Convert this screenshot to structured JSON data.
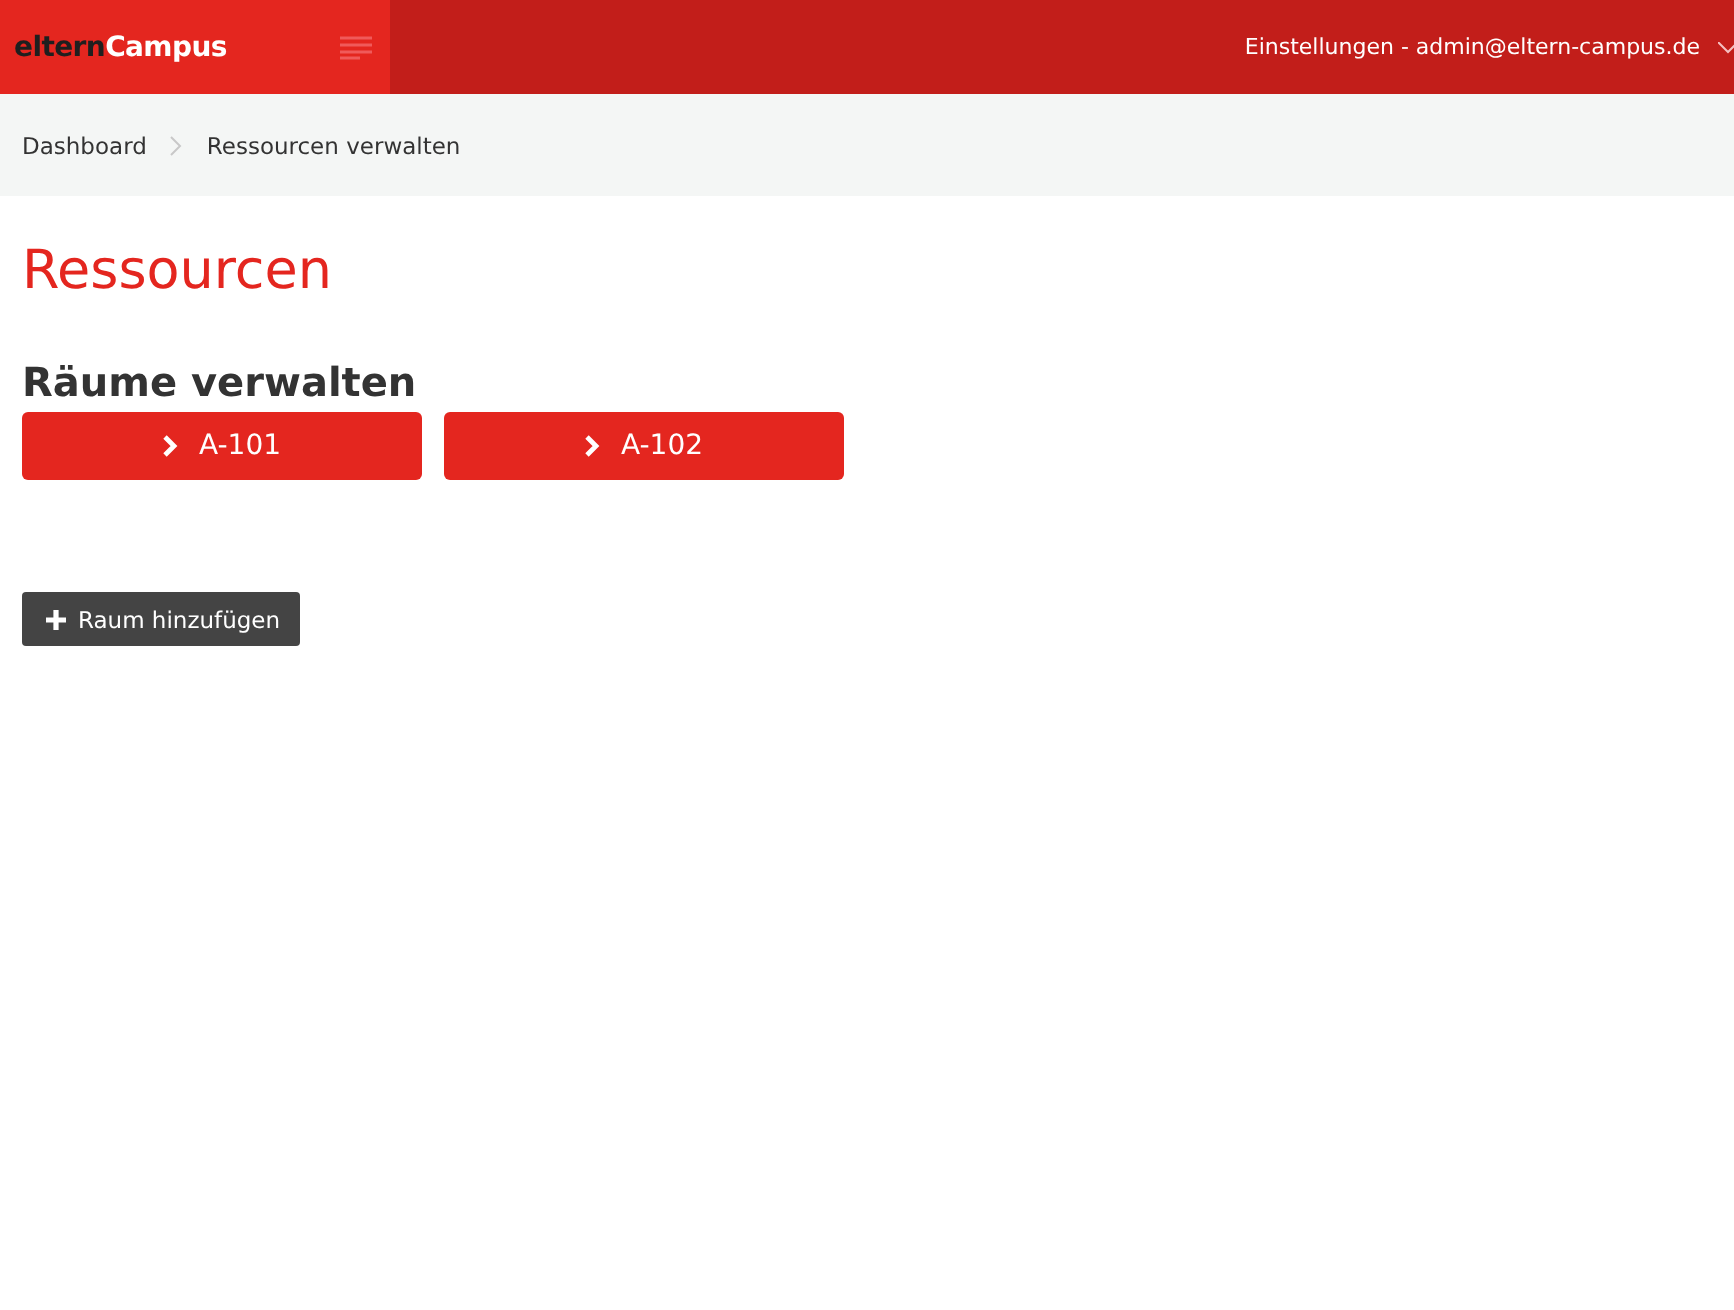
{
  "header": {
    "logo_first": "eltern",
    "logo_second": "Campus",
    "user_menu": "Einstellungen - admin@eltern-campus.de"
  },
  "breadcrumb": [
    "Dashboard",
    "Ressourcen verwalten"
  ],
  "page_title": "Ressourcen",
  "section_title": "Räume verwalten",
  "rooms": [
    "A-101",
    "A-102"
  ],
  "add_button": "Raum hinzufügen"
}
